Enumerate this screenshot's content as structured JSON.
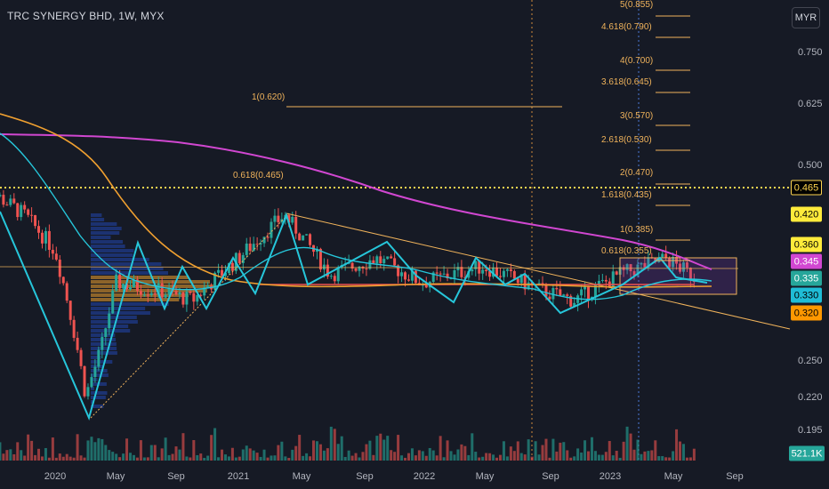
{
  "header": {
    "title": "TRC SYNERGY BHD, 1W, MYX",
    "currency_button": "MYR"
  },
  "y_axis_ticks": [
    "0.750",
    "0.625",
    "0.500",
    "0.250",
    "0.220",
    "0.195"
  ],
  "x_axis_ticks": [
    "2020",
    "May",
    "Sep",
    "2021",
    "May",
    "Sep",
    "2022",
    "May",
    "Sep",
    "2023",
    "May",
    "Sep"
  ],
  "price_tags": [
    {
      "label": "0.465",
      "bg": "#000000",
      "fg": "#ffd54f",
      "border": "#ffd54f"
    },
    {
      "label": "0.420",
      "bg": "#ffeb3b",
      "fg": "#000000",
      "border": "#ffeb3b"
    },
    {
      "label": "0.360",
      "bg": "#ffeb3b",
      "fg": "#000000",
      "border": "#ffeb3b"
    },
    {
      "label": "0.345",
      "bg": "#d147d1",
      "fg": "#ffffff",
      "border": "#d147d1"
    },
    {
      "label": "0.335",
      "bg": "#26a69a",
      "fg": "#ffffff",
      "border": "#26a69a"
    },
    {
      "label": "0.330",
      "bg": "#1fbcd6",
      "fg": "#000000",
      "border": "#1fbcd6"
    },
    {
      "label": "0.320",
      "bg": "#ff9800",
      "fg": "#000000",
      "border": "#ff9800"
    }
  ],
  "volume_tag": {
    "label": "521.1K",
    "bg": "#26a69a",
    "fg": "#ffffff"
  },
  "fib_levels": [
    {
      "label": "5(0.855)"
    },
    {
      "label": "4.618(0.790)"
    },
    {
      "label": "4(0.700)"
    },
    {
      "label": "3.618(0.645)"
    },
    {
      "label": "3(0.570)"
    },
    {
      "label": "2.618(0.530)"
    },
    {
      "label": "2(0.470)"
    },
    {
      "label": "1.618(0.435)"
    },
    {
      "label": "1(0.385)"
    },
    {
      "label": "0.618(0.355)"
    },
    {
      "label": "1(0.620)"
    },
    {
      "label": "0.618(0.465)"
    }
  ],
  "chart_data": {
    "type": "candlestick",
    "symbol": "TRC SYNERGY BHD",
    "interval": "1W",
    "exchange": "MYX",
    "y_scale": "log",
    "ylim": [
      0.18,
      0.8
    ],
    "x_range": [
      "2019-08",
      "2023-10"
    ],
    "overlays": [
      "moving average (cyan)",
      "moving average (orange)",
      "moving average (magenta)",
      "zigzag (cyan)",
      "volume profile",
      "fibonacci extensions",
      "trend lines"
    ],
    "approx_close_path": [
      {
        "x": "2019-08",
        "y": 0.47
      },
      {
        "x": "2019-11",
        "y": 0.42
      },
      {
        "x": "2020-01",
        "y": 0.37
      },
      {
        "x": "2020-03",
        "y": 0.22
      },
      {
        "x": "2020-04",
        "y": 0.26
      },
      {
        "x": "2020-05",
        "y": 0.33
      },
      {
        "x": "2020-08",
        "y": 0.32
      },
      {
        "x": "2020-10",
        "y": 0.31
      },
      {
        "x": "2021-01",
        "y": 0.36
      },
      {
        "x": "2021-04",
        "y": 0.42
      },
      {
        "x": "2021-07",
        "y": 0.34
      },
      {
        "x": "2021-10",
        "y": 0.36
      },
      {
        "x": "2022-01",
        "y": 0.33
      },
      {
        "x": "2022-05",
        "y": 0.35
      },
      {
        "x": "2022-09",
        "y": 0.32
      },
      {
        "x": "2022-11",
        "y": 0.31
      },
      {
        "x": "2023-02",
        "y": 0.34
      },
      {
        "x": "2023-05",
        "y": 0.36
      },
      {
        "x": "2023-07",
        "y": 0.335
      }
    ],
    "last_volume": "521.1K"
  }
}
